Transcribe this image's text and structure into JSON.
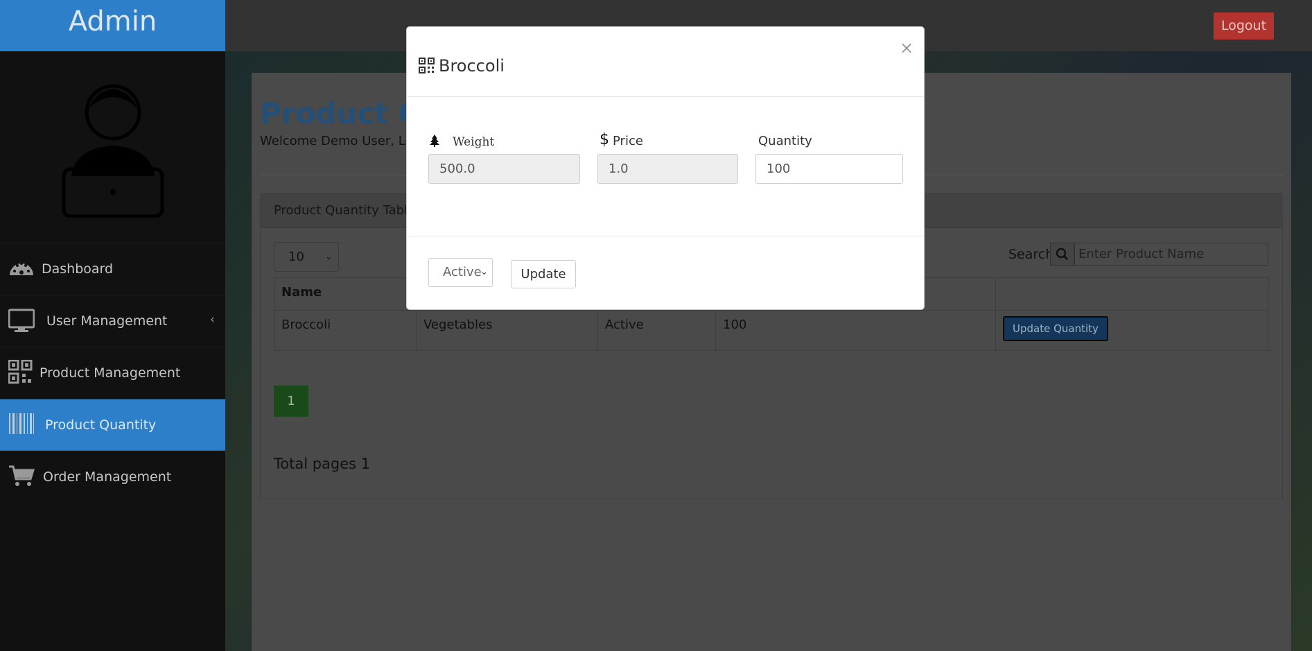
{
  "header": {
    "brand": "Admin",
    "logout_label": "Logout"
  },
  "sidebar": {
    "items": [
      {
        "label": "Dashboard",
        "icon": "dashboard-icon"
      },
      {
        "label": "User Management",
        "icon": "monitor-icon"
      },
      {
        "label": "Product Management",
        "icon": "qrcode-icon"
      },
      {
        "label": "Product Quantity",
        "icon": "barcode-icon",
        "active": true
      },
      {
        "label": "Order Management",
        "icon": "cart-icon"
      }
    ]
  },
  "main": {
    "title": "Product Quantity",
    "welcome": "Welcome Demo User, Love",
    "card_title": "Product Quantity Table",
    "page_size": "10",
    "search_label": "Search",
    "search_placeholder": "Enter Product Name",
    "table": {
      "headers": [
        "Name",
        "",
        "",
        "",
        ""
      ],
      "rows": [
        {
          "name": "Broccoli",
          "category": "Vegetables",
          "status": "Active",
          "quantity": "100",
          "action": "Update Quantity"
        }
      ]
    },
    "current_page": "1",
    "total_pages": "Total pages 1"
  },
  "modal": {
    "title": "Broccoli",
    "close": "×",
    "weight_label": "Weight",
    "weight_value": "500.0",
    "price_icon": "$",
    "price_label": "Price",
    "price_value": "1.0",
    "quantity_label": "Quantity",
    "quantity_value": "100",
    "status_value": "Active",
    "update_label": "Update"
  },
  "colors": {
    "brand": "#2e7fc9",
    "logout": "#b3332e",
    "pager": "#1a4a1a",
    "update_qty": "#14365a"
  }
}
